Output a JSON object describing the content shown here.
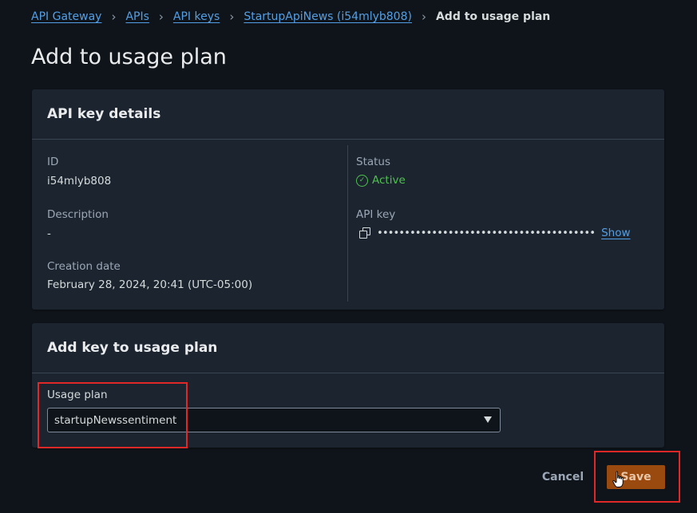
{
  "breadcrumb": {
    "items": [
      "API Gateway",
      "APIs",
      "API keys",
      "StartupApiNews (i54mlyb808)"
    ],
    "current": "Add to usage plan"
  },
  "page": {
    "title": "Add to usage plan"
  },
  "details": {
    "header": "API key details",
    "id_label": "ID",
    "id_value": "i54mlyb808",
    "description_label": "Description",
    "description_value": "-",
    "creation_label": "Creation date",
    "creation_value": "February 28, 2024, 20:41 (UTC-05:00)",
    "status_label": "Status",
    "status_value": "Active",
    "apikey_label": "API key",
    "apikey_masked": "••••••••••••••••••••••••••••••••••••••••",
    "show_link": "Show"
  },
  "usage": {
    "header": "Add key to usage plan",
    "field_label": "Usage plan",
    "selected_value": "startupNewssentiment"
  },
  "actions": {
    "cancel": "Cancel",
    "save": "Save"
  },
  "colors": {
    "background": "#0f141a",
    "panel": "#1c2430",
    "link": "#539fe5",
    "active": "#4ec04e",
    "primary_button": "#9b4a0f",
    "highlight_box": "#e02828"
  }
}
